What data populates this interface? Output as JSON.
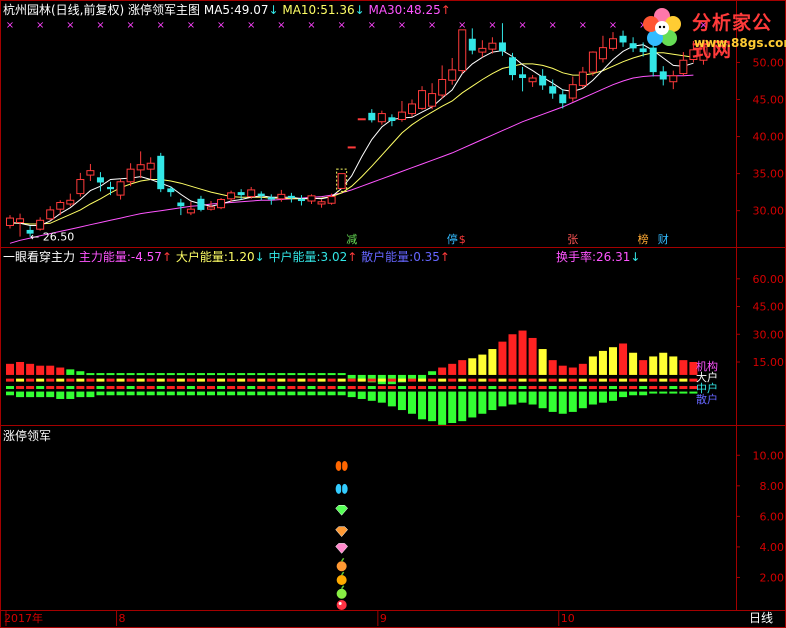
{
  "colors": {
    "bg": "#000000",
    "frame": "#a40000",
    "up": "#ff3b3b",
    "down": "#33e6e6",
    "ma5": "#ffffff",
    "ma10": "#ffff66",
    "ma30": "#ff55ff",
    "axis_text": "#d40000",
    "date_text": "#d40000",
    "marker_x": "#ff44ff"
  },
  "header_main": {
    "stock": "杭州园林(日线,前复权)",
    "indicator": "涨停领军主图",
    "ma5_label": "MA5:",
    "ma5_value": "49.07",
    "ma5_arrow": "↓",
    "ma10_label": "MA10:",
    "ma10_value": "51.36",
    "ma10_arrow": "↓",
    "ma30_label": "MA30:",
    "ma30_value": "48.25",
    "ma30_arrow": "↑"
  },
  "header_mid": {
    "title": "一眼看穿主力",
    "main_label": "主力能量:",
    "main_value": "-4.57",
    "main_arrow": "↑",
    "big_label": "大户能量:",
    "big_value": "1.20",
    "big_arrow": "↓",
    "mid_label": "中户能量:",
    "mid_value": "3.02",
    "mid_arrow": "↑",
    "small_label": "散户能量:",
    "small_value": "0.35",
    "small_arrow": "↑",
    "turnover_label": "换手率:",
    "turnover_value": "26.31",
    "turnover_arrow": "↓"
  },
  "header_low": {
    "title": "涨停领军"
  },
  "watermark": {
    "title": "分析家公式网",
    "url": "www.88gs.com"
  },
  "chart_data": [
    {
      "type": "candlestick",
      "title": "涨停领军主图",
      "yticks": [
        "30.00",
        "35.00",
        "40.00",
        "45.00",
        "50.00"
      ],
      "ylim": [
        25.5,
        56.0
      ],
      "low_annotation": "26.50",
      "event_labels": [
        "减",
        "停",
        "$",
        "张",
        "榜",
        "财"
      ],
      "candles": [
        {
          "o": 28.0,
          "c": 29.0,
          "h": 29.4,
          "l": 27.6
        },
        {
          "o": 28.4,
          "c": 28.9,
          "h": 29.6,
          "l": 26.5
        },
        {
          "o": 27.4,
          "c": 26.9,
          "h": 27.9,
          "l": 26.5
        },
        {
          "o": 27.5,
          "c": 28.7,
          "h": 29.1,
          "l": 27.3
        },
        {
          "o": 28.9,
          "c": 30.1,
          "h": 30.6,
          "l": 28.7
        },
        {
          "o": 30.2,
          "c": 31.1,
          "h": 31.4,
          "l": 29.4
        },
        {
          "o": 30.9,
          "c": 31.4,
          "h": 32.3,
          "l": 30.6
        },
        {
          "o": 32.3,
          "c": 34.2,
          "h": 35.1,
          "l": 31.9
        },
        {
          "o": 34.8,
          "c": 35.4,
          "h": 36.3,
          "l": 34.0
        },
        {
          "o": 34.5,
          "c": 33.8,
          "h": 35.2,
          "l": 32.6
        },
        {
          "o": 33.2,
          "c": 32.9,
          "h": 33.9,
          "l": 32.1
        },
        {
          "o": 32.1,
          "c": 33.9,
          "h": 34.3,
          "l": 31.5
        },
        {
          "o": 33.9,
          "c": 35.6,
          "h": 36.4,
          "l": 33.3
        },
        {
          "o": 35.5,
          "c": 36.2,
          "h": 38.0,
          "l": 34.4
        },
        {
          "o": 35.6,
          "c": 36.4,
          "h": 37.2,
          "l": 34.2
        },
        {
          "o": 37.4,
          "c": 32.9,
          "h": 37.8,
          "l": 32.5
        },
        {
          "o": 33.0,
          "c": 32.5,
          "h": 33.3,
          "l": 31.9
        },
        {
          "o": 31.1,
          "c": 30.6,
          "h": 31.6,
          "l": 29.4
        },
        {
          "o": 29.7,
          "c": 30.2,
          "h": 31.2,
          "l": 29.4
        },
        {
          "o": 31.6,
          "c": 30.1,
          "h": 32.0,
          "l": 29.9
        },
        {
          "o": 30.2,
          "c": 30.5,
          "h": 31.3,
          "l": 30.0
        },
        {
          "o": 30.4,
          "c": 31.5,
          "h": 31.7,
          "l": 30.2
        },
        {
          "o": 31.6,
          "c": 32.4,
          "h": 32.7,
          "l": 31.2
        },
        {
          "o": 32.5,
          "c": 32.1,
          "h": 32.9,
          "l": 31.5
        },
        {
          "o": 31.9,
          "c": 32.8,
          "h": 33.2,
          "l": 31.6
        },
        {
          "o": 32.3,
          "c": 32.0,
          "h": 32.6,
          "l": 31.4
        },
        {
          "o": 31.8,
          "c": 31.5,
          "h": 32.2,
          "l": 30.8
        },
        {
          "o": 31.6,
          "c": 32.2,
          "h": 32.8,
          "l": 31.2
        },
        {
          "o": 32.0,
          "c": 31.7,
          "h": 32.4,
          "l": 31.1
        },
        {
          "o": 31.6,
          "c": 31.3,
          "h": 32.1,
          "l": 30.7
        },
        {
          "o": 31.3,
          "c": 32.0,
          "h": 32.2,
          "l": 30.9
        },
        {
          "o": 30.9,
          "c": 31.2,
          "h": 31.5,
          "l": 30.4
        },
        {
          "o": 31.0,
          "c": 31.9,
          "h": 32.3,
          "l": 30.8
        },
        {
          "o": 33.0,
          "c": 35.0,
          "h": 35.0,
          "l": 33.0
        },
        {
          "o": 38.6,
          "c": 38.6,
          "h": 38.6,
          "l": 38.6
        },
        {
          "o": 42.4,
          "c": 42.4,
          "h": 42.4,
          "l": 42.4
        },
        {
          "o": 43.2,
          "c": 42.2,
          "h": 43.7,
          "l": 41.9
        },
        {
          "o": 42.0,
          "c": 43.1,
          "h": 43.5,
          "l": 41.6
        },
        {
          "o": 42.6,
          "c": 42.1,
          "h": 43.0,
          "l": 41.4
        },
        {
          "o": 42.3,
          "c": 43.3,
          "h": 44.8,
          "l": 42.0
        },
        {
          "o": 43.1,
          "c": 44.4,
          "h": 45.0,
          "l": 42.7
        },
        {
          "o": 43.8,
          "c": 46.2,
          "h": 46.8,
          "l": 43.6
        },
        {
          "o": 44.1,
          "c": 45.8,
          "h": 47.2,
          "l": 43.7
        },
        {
          "o": 45.6,
          "c": 47.7,
          "h": 49.6,
          "l": 45.1
        },
        {
          "o": 47.6,
          "c": 49.0,
          "h": 50.6,
          "l": 47.0
        },
        {
          "o": 48.9,
          "c": 54.4,
          "h": 54.4,
          "l": 48.5
        },
        {
          "o": 53.2,
          "c": 51.6,
          "h": 54.6,
          "l": 51.1
        },
        {
          "o": 51.4,
          "c": 51.9,
          "h": 53.0,
          "l": 50.7
        },
        {
          "o": 51.8,
          "c": 52.6,
          "h": 53.4,
          "l": 51.2
        },
        {
          "o": 52.7,
          "c": 51.5,
          "h": 55.3,
          "l": 50.9
        },
        {
          "o": 50.7,
          "c": 48.3,
          "h": 51.3,
          "l": 47.6
        },
        {
          "o": 48.4,
          "c": 47.9,
          "h": 49.4,
          "l": 46.1
        },
        {
          "o": 47.4,
          "c": 47.9,
          "h": 48.3,
          "l": 46.7
        },
        {
          "o": 48.2,
          "c": 46.9,
          "h": 49.1,
          "l": 46.3
        },
        {
          "o": 46.8,
          "c": 45.8,
          "h": 47.7,
          "l": 45.1
        },
        {
          "o": 45.7,
          "c": 44.5,
          "h": 46.4,
          "l": 43.8
        },
        {
          "o": 45.2,
          "c": 47.0,
          "h": 48.1,
          "l": 44.7
        },
        {
          "o": 46.9,
          "c": 48.7,
          "h": 49.4,
          "l": 46.5
        },
        {
          "o": 48.7,
          "c": 51.4,
          "h": 51.5,
          "l": 48.2
        },
        {
          "o": 50.5,
          "c": 52.0,
          "h": 53.6,
          "l": 50.0
        },
        {
          "o": 51.9,
          "c": 53.2,
          "h": 54.1,
          "l": 51.6
        },
        {
          "o": 53.6,
          "c": 52.7,
          "h": 54.3,
          "l": 52.1
        },
        {
          "o": 52.6,
          "c": 51.9,
          "h": 53.4,
          "l": 51.4
        },
        {
          "o": 51.9,
          "c": 51.4,
          "h": 52.7,
          "l": 50.8
        },
        {
          "o": 52.0,
          "c": 48.7,
          "h": 52.6,
          "l": 48.1
        },
        {
          "o": 48.8,
          "c": 47.7,
          "h": 49.5,
          "l": 46.9
        },
        {
          "o": 47.4,
          "c": 48.2,
          "h": 48.9,
          "l": 46.4
        },
        {
          "o": 48.5,
          "c": 50.3,
          "h": 51.4,
          "l": 48.2
        },
        {
          "o": 50.4,
          "c": 51.7,
          "h": 52.9,
          "l": 50.0
        },
        {
          "o": 50.3,
          "c": 52.1,
          "h": 52.6,
          "l": 49.7
        }
      ],
      "ma5": [
        28.4,
        28.3,
        28.0,
        28.0,
        28.6,
        29.6,
        30.4,
        31.5,
        32.7,
        33.3,
        34.2,
        34.3,
        34.4,
        34.6,
        34.2,
        33.7,
        33.2,
        32.2,
        31.3,
        30.9,
        30.6,
        30.9,
        31.3,
        31.5,
        31.8,
        32.0,
        31.8,
        31.8,
        31.8,
        31.6,
        31.7,
        31.6,
        31.9,
        33.0,
        34.7,
        37.3,
        39.6,
        41.3,
        42.3,
        42.5,
        42.6,
        43.3,
        44.0,
        45.2,
        46.3,
        48.5,
        49.8,
        50.7,
        51.4,
        51.6,
        50.8,
        49.7,
        48.9,
        48.0,
        47.2,
        46.3,
        46.1,
        46.5,
        47.6,
        49.0,
        50.4,
        51.5,
        52.2,
        52.4,
        51.6,
        50.6,
        49.6,
        49.5,
        49.9
      ],
      "ma10": [
        28.3,
        28.3,
        28.2,
        28.2,
        28.3,
        28.9,
        29.5,
        30.1,
        30.9,
        31.6,
        32.4,
        33.1,
        33.6,
        34.0,
        34.2,
        34.2,
        34.0,
        33.7,
        33.3,
        32.9,
        32.5,
        32.2,
        31.9,
        31.8,
        31.8,
        31.8,
        31.7,
        31.7,
        31.6,
        31.6,
        31.6,
        31.7,
        31.9,
        32.4,
        33.3,
        34.6,
        36.0,
        37.5,
        39.0,
        40.5,
        41.6,
        42.5,
        43.3,
        44.1,
        44.8,
        45.9,
        46.8,
        47.7,
        48.5,
        49.2,
        49.5,
        49.8,
        49.8,
        49.6,
        49.2,
        48.6,
        48.3,
        48.3,
        48.5,
        48.9,
        49.5,
        50.1,
        50.6,
        51.0,
        51.3,
        51.3,
        51.1,
        50.9,
        50.7
      ],
      "ma30": [
        25.6,
        26.0,
        26.3,
        26.6,
        26.9,
        27.2,
        27.5,
        27.8,
        28.1,
        28.4,
        28.7,
        29.0,
        29.3,
        29.6,
        29.8,
        30.0,
        30.2,
        30.4,
        30.6,
        30.7,
        30.9,
        31.0,
        31.1,
        31.2,
        31.3,
        31.4,
        31.4,
        31.5,
        31.6,
        31.7,
        31.8,
        31.9,
        32.1,
        32.4,
        32.8,
        33.3,
        33.8,
        34.3,
        34.8,
        35.3,
        35.8,
        36.3,
        36.8,
        37.3,
        37.8,
        38.4,
        39.0,
        39.6,
        40.2,
        40.8,
        41.4,
        42.0,
        42.5,
        43.0,
        43.5,
        44.0,
        44.6,
        45.2,
        45.8,
        46.4,
        47.0,
        47.5,
        47.9,
        48.1,
        48.2,
        48.2,
        48.2,
        48.2,
        48.3
      ]
    },
    {
      "type": "bar",
      "title": "一眼看穿主力",
      "yticks": [
        "15.00",
        "30.00",
        "45.00",
        "60.00"
      ],
      "ylim": [
        -18,
        68
      ],
      "legend_labels": [
        "机构",
        "大户",
        "中户",
        "散户"
      ],
      "main_force": [
        6,
        7,
        6,
        5,
        5,
        4,
        3,
        2,
        1,
        1,
        1,
        1,
        1,
        1,
        1,
        1,
        1,
        1,
        1,
        1,
        1,
        1,
        1,
        1,
        1,
        1,
        1,
        1,
        1,
        1,
        1,
        1,
        1,
        1,
        -2,
        -3,
        -4,
        -5,
        -5,
        -4,
        -3,
        -3,
        2,
        4,
        6,
        8,
        9,
        11,
        14,
        18,
        22,
        24,
        20,
        14,
        8,
        5,
        4,
        6,
        10,
        13,
        15,
        17,
        12,
        8,
        10,
        12,
        10,
        8,
        7
      ],
      "retail": [
        -2,
        -3,
        -3,
        -3,
        -3,
        -4,
        -4,
        -3,
        -3,
        -2,
        -2,
        -2,
        -2,
        -2,
        -2,
        -2,
        -2,
        -2,
        -2,
        -2,
        -2,
        -2,
        -2,
        -2,
        -2,
        -2,
        -2,
        -2,
        -2,
        -2,
        -2,
        -2,
        -2,
        -2,
        -3,
        -4,
        -5,
        -6,
        -8,
        -10,
        -12,
        -15,
        -16,
        -18,
        -17,
        -16,
        -14,
        -12,
        -10,
        -8,
        -7,
        -6,
        -7,
        -9,
        -11,
        -12,
        -11,
        -9,
        -7,
        -6,
        -5,
        -3,
        -2,
        -2,
        -1,
        -1,
        -1,
        -1,
        -1
      ]
    },
    {
      "type": "scatter",
      "title": "涨停领军",
      "yticks": [
        "2.00",
        "4.00",
        "6.00",
        "8.00",
        "10.00"
      ],
      "ylim": [
        0,
        11
      ],
      "x_labels": [
        "2017年",
        "8",
        "9",
        "10"
      ],
      "icons": [
        {
          "index": 33,
          "y": 9.3,
          "icon": "butterfly-icon",
          "color": "#ff6600"
        },
        {
          "index": 33,
          "y": 7.8,
          "icon": "butterfly-icon",
          "color": "#33ccff"
        },
        {
          "index": 33,
          "y": 6.4,
          "icon": "gem-icon",
          "color": "#55ff55"
        },
        {
          "index": 33,
          "y": 5.0,
          "icon": "gem-icon",
          "color": "#ff9933"
        },
        {
          "index": 33,
          "y": 3.9,
          "icon": "gem-icon",
          "color": "#ff88cc"
        },
        {
          "index": 33,
          "y": 2.8,
          "icon": "fruit-icon",
          "color": "#ff9933"
        },
        {
          "index": 33,
          "y": 1.9,
          "icon": "fruit-icon",
          "color": "#ffaa00"
        },
        {
          "index": 33,
          "y": 1.0,
          "icon": "fruit-icon",
          "color": "#88ee44"
        },
        {
          "index": 33,
          "y": 0.2,
          "icon": "ball-icon",
          "color": "#ff3344"
        }
      ],
      "footer_right": "日线"
    }
  ]
}
